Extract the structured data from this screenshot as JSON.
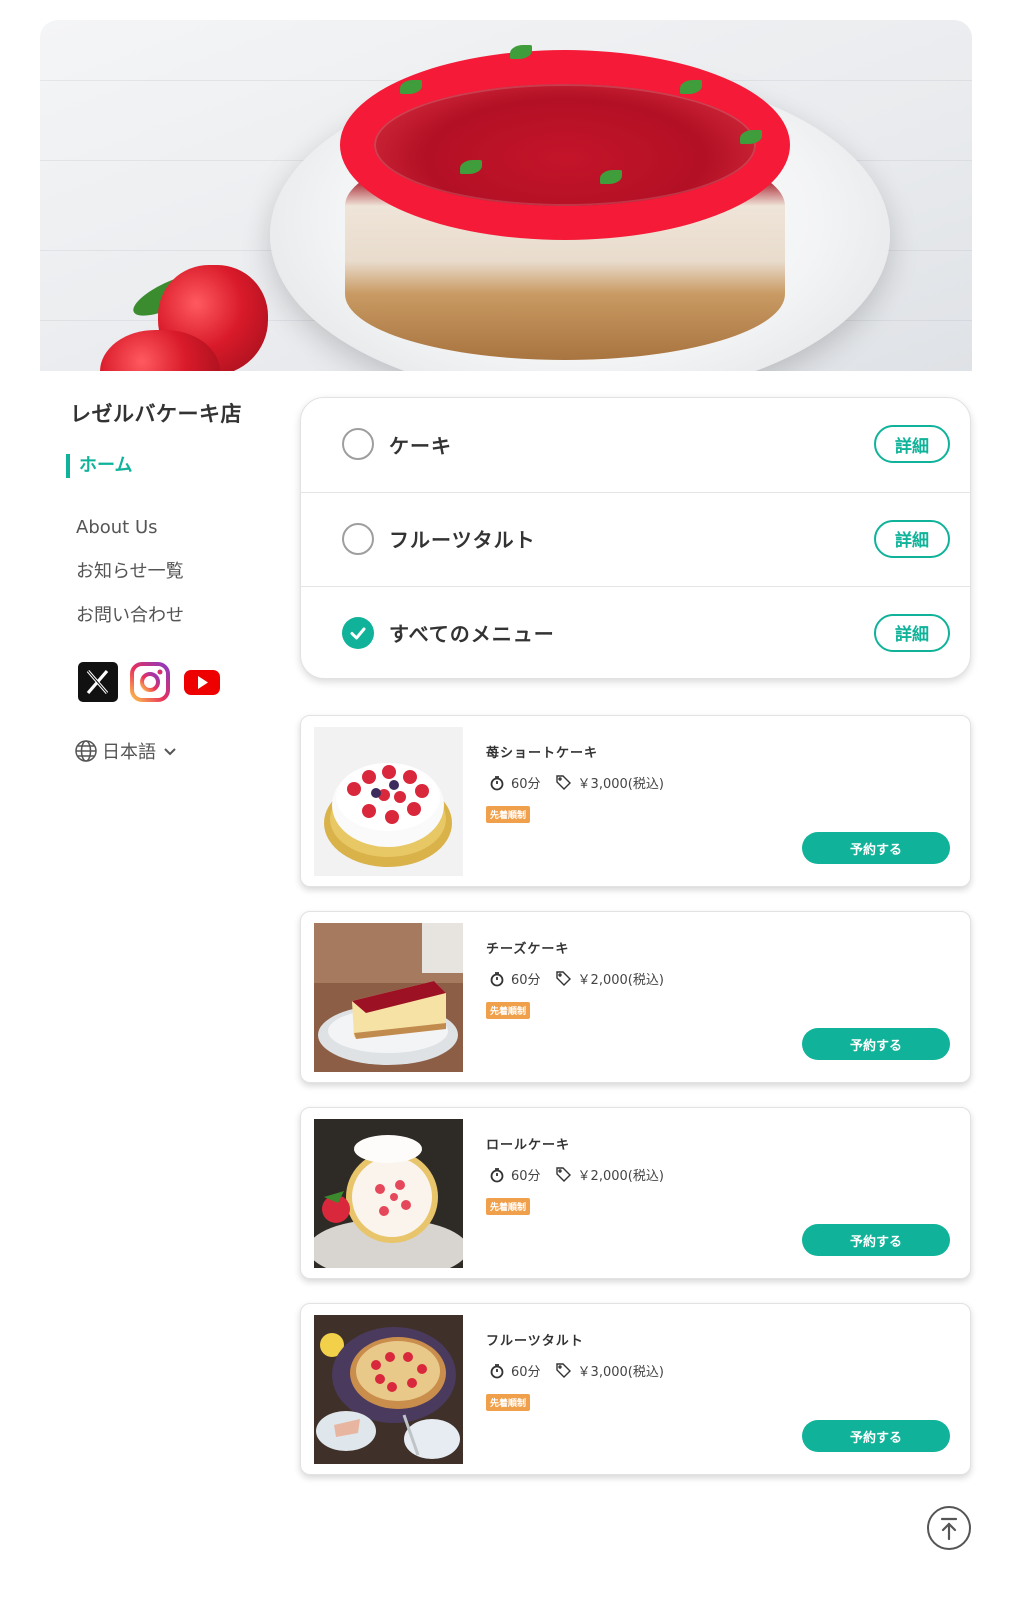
{
  "shop": {
    "name": "レゼルバケーキ店"
  },
  "nav": {
    "home": "ホーム",
    "items": [
      "About Us",
      "お知らせ一覧",
      "お問い合わせ"
    ]
  },
  "social": [
    "x-icon",
    "instagram-icon",
    "youtube-icon"
  ],
  "language": {
    "label": "日本語"
  },
  "categories": [
    {
      "label": "ケーキ",
      "checked": false,
      "detail": "詳細"
    },
    {
      "label": "フルーツタルト",
      "checked": false,
      "detail": "詳細"
    },
    {
      "label": "すべてのメニュー",
      "checked": true,
      "detail": "詳細"
    }
  ],
  "menu_items": [
    {
      "name": "苺ショートケーキ",
      "duration": "60分",
      "price": "￥3,000(税込)",
      "badge": "先着順制",
      "button": "予約する"
    },
    {
      "name": "チーズケーキ",
      "duration": "60分",
      "price": "￥2,000(税込)",
      "badge": "先着順制",
      "button": "予約する"
    },
    {
      "name": "ロールケーキ",
      "duration": "60分",
      "price": "￥2,000(税込)",
      "badge": "先着順制",
      "button": "予約する"
    },
    {
      "name": "フルーツタルト",
      "duration": "60分",
      "price": "￥3,000(税込)",
      "badge": "先着順制",
      "button": "予約する"
    }
  ],
  "colors": {
    "accent": "#10b39a",
    "badge": "#f0a04b"
  }
}
